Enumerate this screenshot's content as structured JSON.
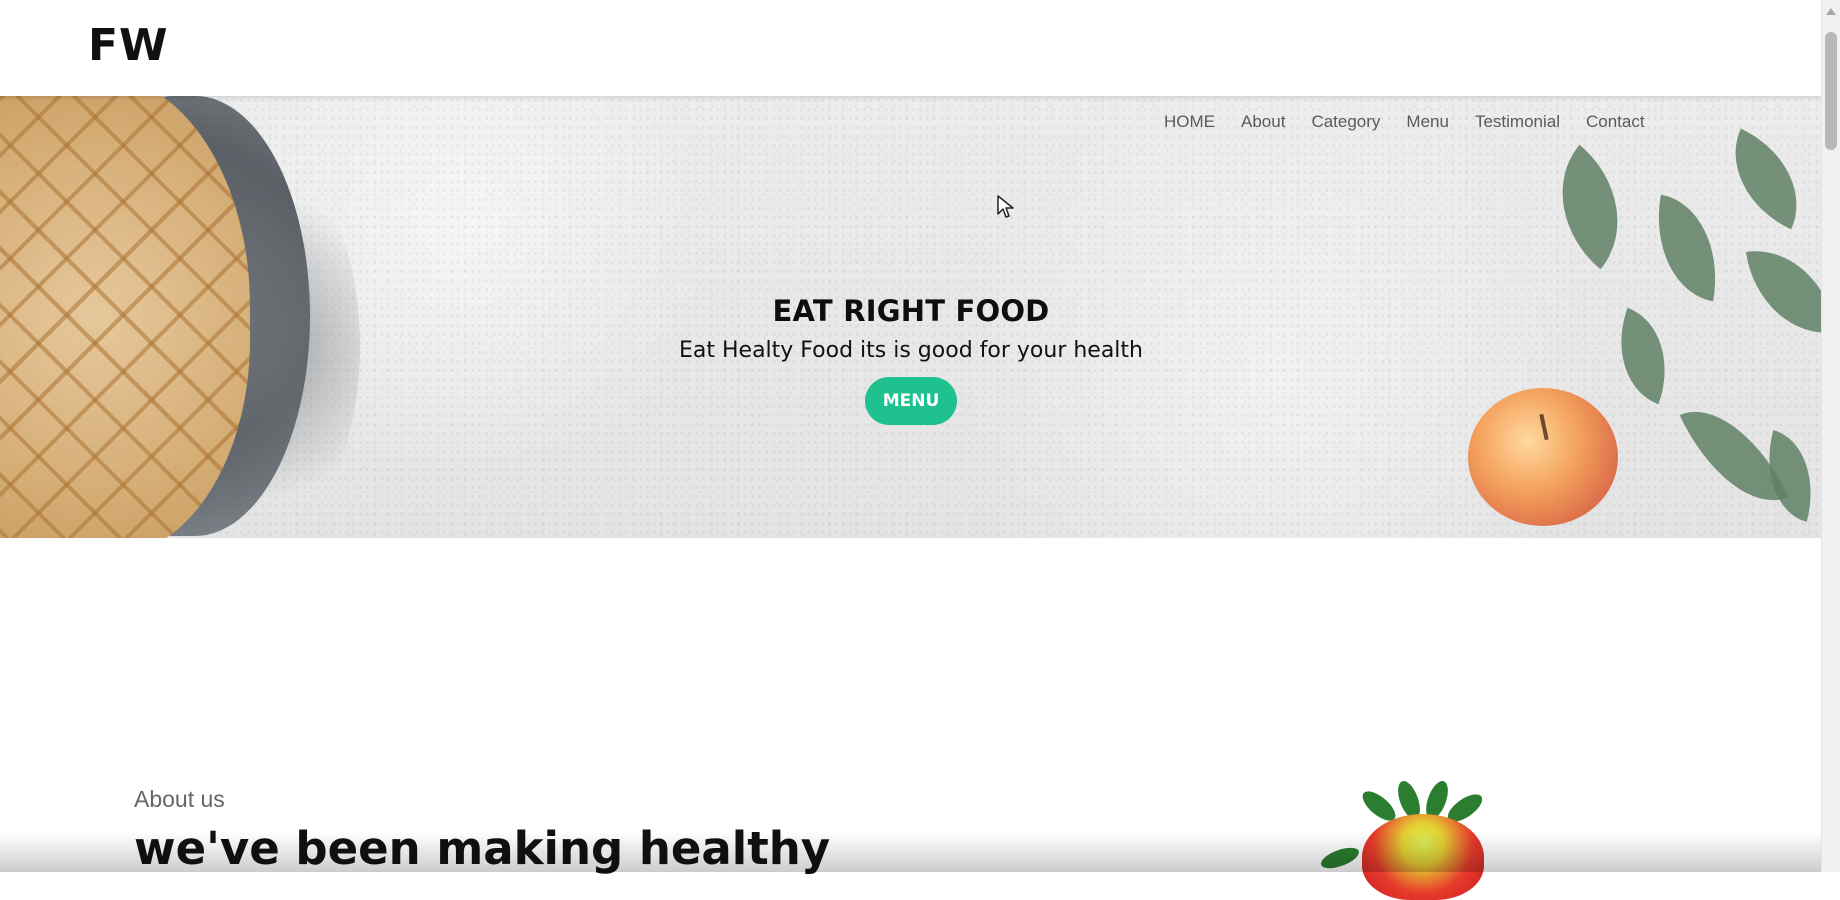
{
  "brand": {
    "logo_text": "FW"
  },
  "nav": {
    "items": [
      {
        "label": "HOME"
      },
      {
        "label": "About"
      },
      {
        "label": "Category"
      },
      {
        "label": "Menu"
      },
      {
        "label": "Testimonial"
      },
      {
        "label": "Contact"
      }
    ]
  },
  "hero": {
    "title": "EAT RIGHT FOOD",
    "subtitle": "Eat Healty Food its is good for your health",
    "button_label": "MENU",
    "button_color": "#1fc18f"
  },
  "about": {
    "label": "About us",
    "headline": "we've been making healthy"
  }
}
